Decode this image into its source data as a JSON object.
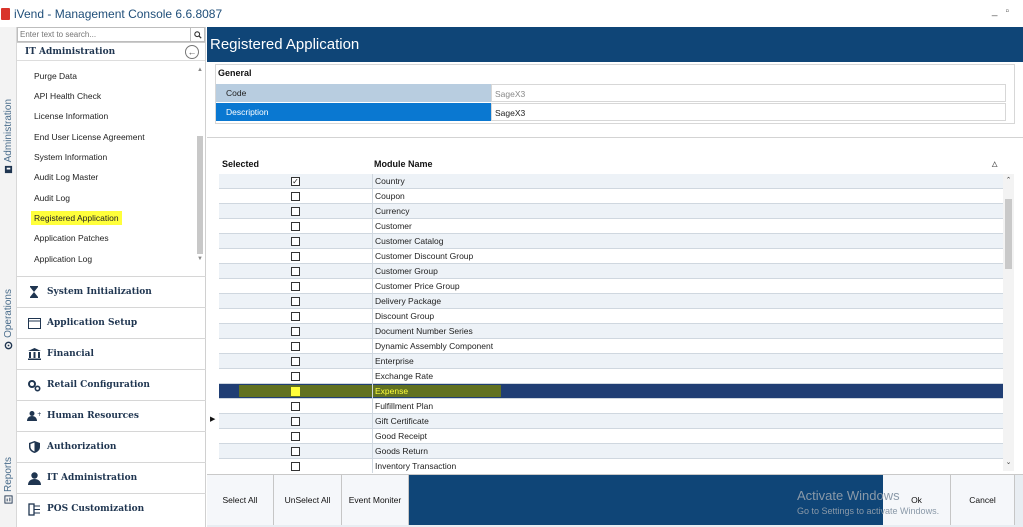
{
  "window": {
    "title": "iVend - Management Console  6.6.8087",
    "controls": [
      "_",
      "▫",
      "✕"
    ]
  },
  "vtabs": [
    {
      "label": "Administration"
    },
    {
      "label": "Operations"
    },
    {
      "label": "Reports"
    }
  ],
  "sidebar": {
    "search_placeholder": "Enter text to search...",
    "group_title": "IT Administration",
    "submenu": [
      {
        "label": "Purge Data"
      },
      {
        "label": "API Health Check"
      },
      {
        "label": "License Information"
      },
      {
        "label": "End User License Agreement"
      },
      {
        "label": "System Information"
      },
      {
        "label": "Audit Log Master"
      },
      {
        "label": "Audit Log"
      },
      {
        "label": "Registered Application"
      },
      {
        "label": "Application Patches"
      },
      {
        "label": "Application Log"
      }
    ],
    "nav": [
      {
        "label": "System Initialization",
        "icon": "hourglass-icon"
      },
      {
        "label": "Application Setup",
        "icon": "window-icon"
      },
      {
        "label": "Financial",
        "icon": "bank-icon"
      },
      {
        "label": "Retail Configuration",
        "icon": "gears-icon"
      },
      {
        "label": "Human Resources",
        "icon": "people-icon"
      },
      {
        "label": "Authorization",
        "icon": "shield-icon"
      },
      {
        "label": "IT Administration",
        "icon": "person-icon"
      },
      {
        "label": "POS Customization",
        "icon": "pos-icon"
      }
    ]
  },
  "main": {
    "title": "Registered Application",
    "general": {
      "title": "General",
      "code_label": "Code",
      "code_value": "SageX3",
      "desc_label": "Description",
      "desc_value": "SageX3"
    },
    "grid": {
      "col_selected": "Selected",
      "col_module": "Module Name",
      "rows": [
        {
          "name": "Country",
          "checked": true
        },
        {
          "name": "Coupon",
          "checked": false
        },
        {
          "name": "Currency",
          "checked": false
        },
        {
          "name": "Customer",
          "checked": false
        },
        {
          "name": "Customer Catalog",
          "checked": false
        },
        {
          "name": "Customer Discount Group",
          "checked": false
        },
        {
          "name": "Customer Group",
          "checked": false
        },
        {
          "name": "Customer Price Group",
          "checked": false
        },
        {
          "name": "Delivery Package",
          "checked": false
        },
        {
          "name": "Discount Group",
          "checked": false
        },
        {
          "name": "Document Number Series",
          "checked": false
        },
        {
          "name": "Dynamic Assembly Component",
          "checked": false
        },
        {
          "name": "Enterprise",
          "checked": false
        },
        {
          "name": "Exchange Rate",
          "checked": false
        },
        {
          "name": "Expense",
          "checked": false,
          "selected": true
        },
        {
          "name": "Fulfillment Plan",
          "checked": false
        },
        {
          "name": "Gift Certificate",
          "checked": false
        },
        {
          "name": "Good Receipt",
          "checked": false
        },
        {
          "name": "Goods Return",
          "checked": false
        },
        {
          "name": "Inventory Transaction",
          "checked": false
        }
      ]
    },
    "footer": {
      "select_all": "Select All",
      "unselect_all": "UnSelect All",
      "event_monitor": "Event Moniter",
      "ok": "Ok",
      "cancel": "Cancel"
    },
    "watermark": {
      "title": "Activate Windows",
      "subtitle": "Go to Settings to activate Windows."
    }
  }
}
